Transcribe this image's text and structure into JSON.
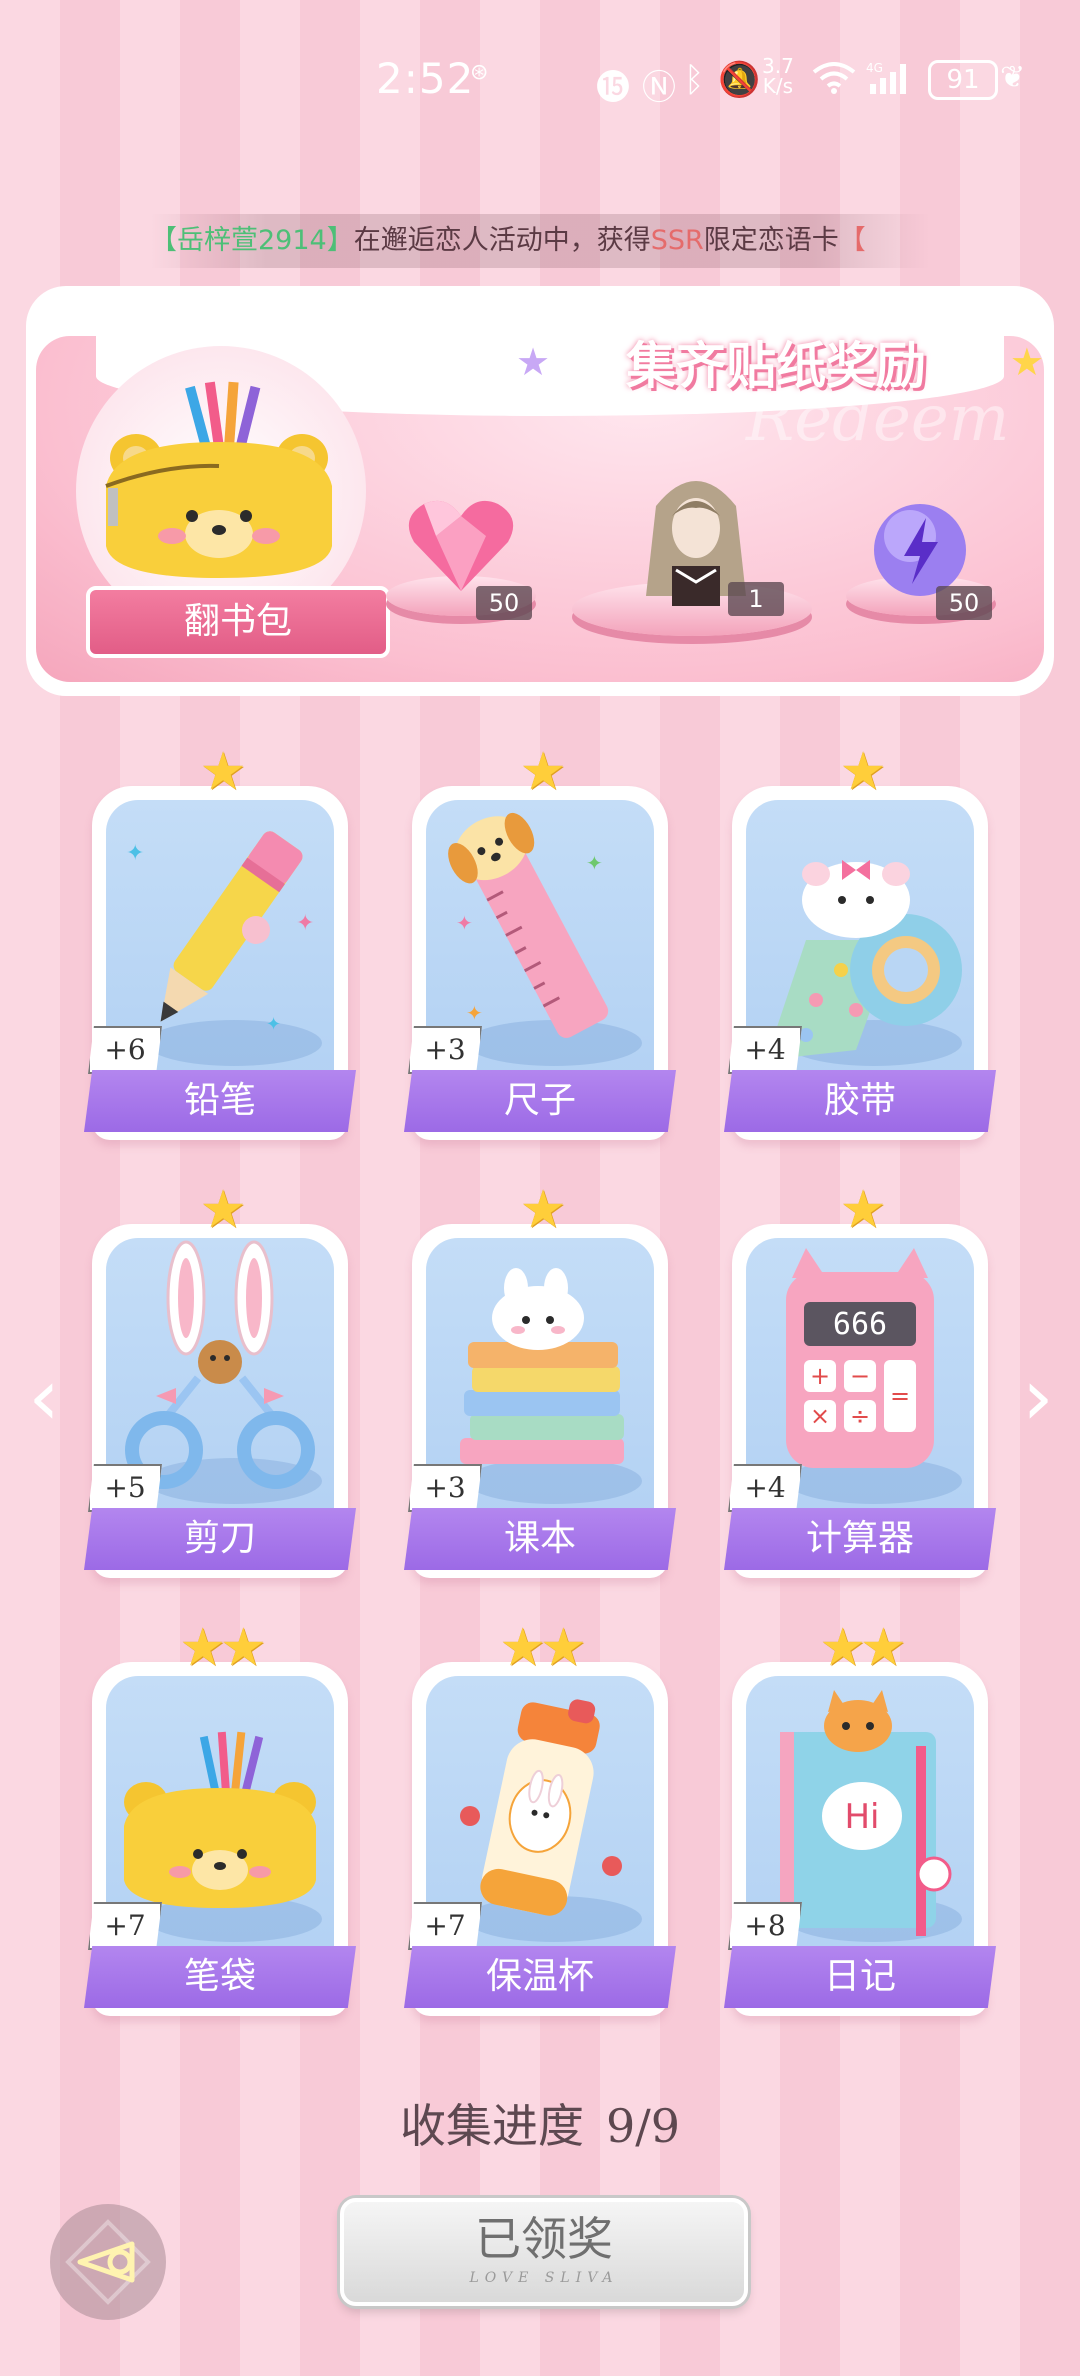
{
  "status_bar": {
    "time": "2:52",
    "speed_value": "3.7",
    "speed_unit": "K/s",
    "battery": "91"
  },
  "marquee": {
    "name": "【岳梓萱2914】",
    "middle": "在邂逅恋人活动中，获得",
    "ssr": "SSR",
    "tail": "限定恋语卡",
    "bracket_next": "【"
  },
  "banner": {
    "title": "集齐贴纸奖励",
    "watermark": "Redeem",
    "pouch_label": "翻书包",
    "rewards": [
      {
        "icon": "pink-heart-gem-icon",
        "count": "50"
      },
      {
        "icon": "character-portrait",
        "count": "1"
      },
      {
        "icon": "purple-lightning-orb-icon",
        "count": "50"
      }
    ]
  },
  "stickers": [
    {
      "label": "铅笔",
      "plus": "+6",
      "stars": "★",
      "icon": "pencil-icon"
    },
    {
      "label": "尺子",
      "plus": "+3",
      "stars": "★",
      "icon": "ruler-icon"
    },
    {
      "label": "胶带",
      "plus": "+4",
      "stars": "★",
      "icon": "tape-icon"
    },
    {
      "label": "剪刀",
      "plus": "+5",
      "stars": "★",
      "icon": "scissors-icon"
    },
    {
      "label": "课本",
      "plus": "+3",
      "stars": "★",
      "icon": "textbooks-icon"
    },
    {
      "label": "计算器",
      "plus": "+4",
      "stars": "★",
      "icon": "calculator-icon"
    },
    {
      "label": "笔袋",
      "plus": "+7",
      "stars": "★★",
      "icon": "pencil-case-icon"
    },
    {
      "label": "保温杯",
      "plus": "+7",
      "stars": "★★",
      "icon": "thermos-icon"
    },
    {
      "label": "日记",
      "plus": "+8",
      "stars": "★★",
      "icon": "diary-icon"
    }
  ],
  "calculator_display": "666",
  "diary_text": "Hi",
  "progress": {
    "label": "收集进度",
    "value": "9/9"
  },
  "claim_button": {
    "label": "已领奖",
    "sublabel": "LOVE SLIVA"
  },
  "nav": {
    "prev": "‹",
    "next": "›"
  }
}
